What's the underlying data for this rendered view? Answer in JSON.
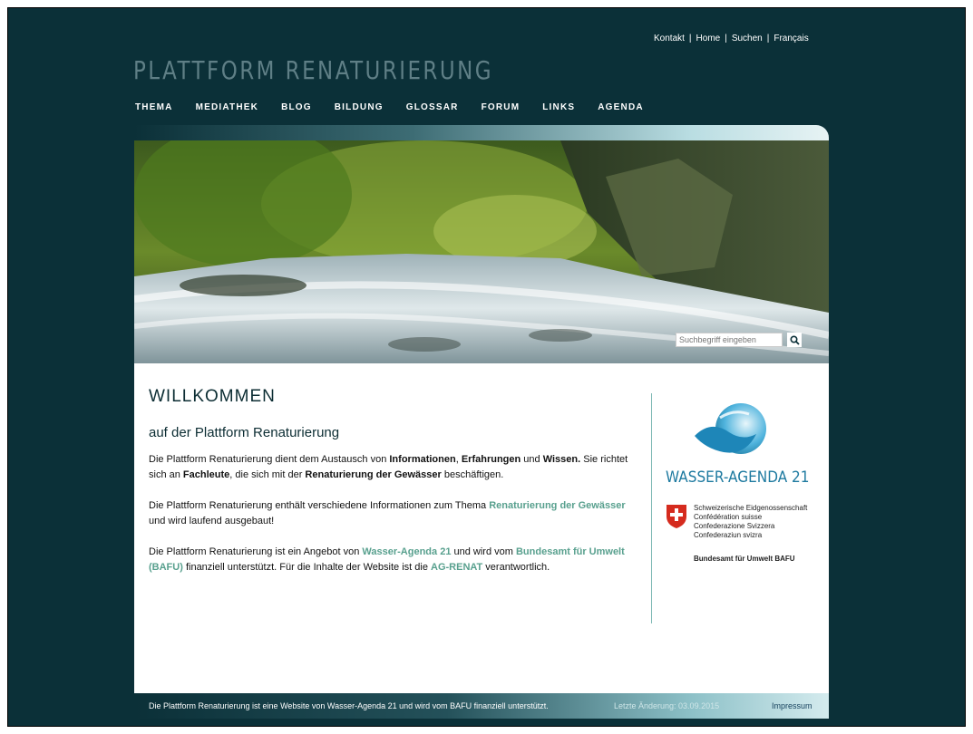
{
  "utility_nav": {
    "items": [
      "Kontakt",
      "Home",
      "Suchen",
      "Français"
    ],
    "separator": "|"
  },
  "logo": {
    "text": "PLATTFORM RENATURIERUNG"
  },
  "main_nav": {
    "items": [
      "THEMA",
      "MEDIATHEK",
      "BLOG",
      "BILDUNG",
      "GLOSSAR",
      "FORUM",
      "LINKS",
      "AGENDA"
    ]
  },
  "search": {
    "placeholder": "Suchbegriff eingeben",
    "icon": "magnifier-icon"
  },
  "welcome": {
    "title": "WILLKOMMEN",
    "subtitle": "auf der Plattform Renaturierung",
    "p1": {
      "t1": "Die Plattform Renaturierung dient dem Austausch von ",
      "b1": "Informationen",
      "t2": ", ",
      "b2": "Erfahrungen",
      "t3": " und ",
      "b3": "Wissen.",
      "t4": " Sie richtet sich an ",
      "b4": "Fachleute",
      "t5": ", die sich mit der ",
      "b5": "Renaturierung der Gewässer",
      "t6": " beschäftigen."
    },
    "p2": {
      "t1": "Die Plattform Renaturierung enthält verschiedene Informationen zum Thema ",
      "link1": "Renaturierung der Gewässer",
      "t2": " und wird laufend ausgebaut!"
    },
    "p3": {
      "t1": "Die Plattform Renaturierung ist ein Angebot von ",
      "link1": "Wasser-Agenda 21",
      "t2": " und wird vom ",
      "link2": "Bundesamt für Umwelt (BAFU)",
      "t3": " finanziell unterstützt. Für die Inhalte der Website ist die ",
      "link3": "AG-RENAT",
      "t4": " verantwortlich."
    }
  },
  "sidebar": {
    "wasser_agenda": "WASSER-AGENDA 21",
    "bafu_names": [
      "Schweizerische Eidgenossenschaft",
      "Confédération suisse",
      "Confederazione Svizzera",
      "Confederaziun svizra"
    ],
    "bafu_office": "Bundesamt für Umwelt BAFU"
  },
  "footer": {
    "text": "Die Plattform Renaturierung ist eine Website von Wasser-Agenda 21 und wird vom BAFU finanziell unterstützt.",
    "last_change": "Letzte Änderung: 03.09.2015",
    "impressum": "Impressum"
  },
  "colors": {
    "background": "#0b3038",
    "link": "#58a08e",
    "wasser_agenda_blue": "#1e7aa0",
    "swiss_red": "#d52b1e"
  }
}
